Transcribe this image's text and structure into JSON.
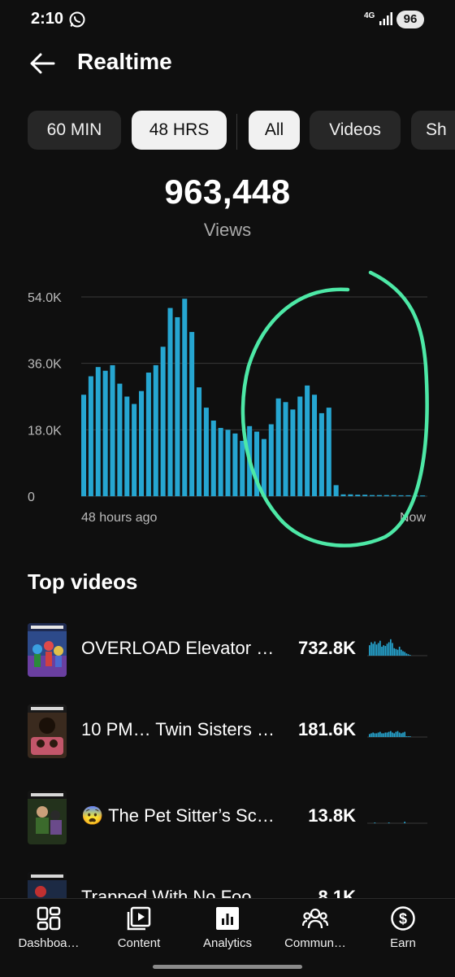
{
  "status": {
    "time": "2:10",
    "network": "4G",
    "battery": "96"
  },
  "header": {
    "title": "Realtime"
  },
  "range_tabs": [
    {
      "label": "60 MIN",
      "selected": false
    },
    {
      "label": "48 HRS",
      "selected": true
    }
  ],
  "type_tabs": [
    {
      "label": "All",
      "selected": true
    },
    {
      "label": "Videos",
      "selected": false
    },
    {
      "label": "Sh",
      "selected": false
    }
  ],
  "summary": {
    "total": "963,448",
    "label": "Views"
  },
  "chart_data": {
    "type": "bar",
    "x_start_label": "48 hours ago",
    "x_end_label": "Now",
    "yticks": [
      "0",
      "18.0K",
      "36.0K",
      "54.0K"
    ],
    "ylim": [
      0,
      54000
    ],
    "bar_color": "#26a6d1",
    "values": [
      27500,
      32500,
      35000,
      34000,
      35500,
      30500,
      27000,
      25000,
      28500,
      33500,
      35500,
      40500,
      51000,
      48500,
      53500,
      44500,
      29500,
      24000,
      20500,
      18500,
      18000,
      17000,
      15000,
      19000,
      17500,
      15500,
      19500,
      26500,
      25500,
      23500,
      27000,
      30000,
      27500,
      22500,
      24000,
      3000,
      500,
      500,
      400,
      400,
      300,
      300,
      300,
      300,
      250,
      250,
      200,
      200
    ],
    "annotation_color": "#4de8a6"
  },
  "top_videos": {
    "title": "Top videos",
    "items": [
      {
        "title": "OVERLOAD Elevator …",
        "views": "732.8K",
        "spark": [
          14,
          18,
          16,
          19,
          15,
          17,
          20,
          12,
          14,
          13,
          16,
          18,
          22,
          17,
          10,
          9,
          8,
          12,
          8,
          6,
          5,
          3,
          2,
          1
        ]
      },
      {
        "title": "10 PM… Twin Sisters …",
        "views": "181.6K",
        "spark": [
          4,
          5,
          6,
          5,
          5,
          6,
          7,
          5,
          5,
          6,
          6,
          7,
          8,
          6,
          5,
          7,
          8,
          6,
          5,
          6,
          7,
          1,
          1,
          1
        ]
      },
      {
        "title": "😨 The Pet Sitter’s Sc…",
        "views": "13.8K",
        "spark": [
          0,
          0,
          0,
          1,
          0,
          0,
          0,
          0,
          0,
          0,
          0,
          1,
          0,
          0,
          0,
          0,
          0,
          0,
          0,
          0,
          2,
          0,
          0,
          0
        ]
      },
      {
        "title": "Trapped With No Foo…",
        "views": "8.1K",
        "spark": []
      }
    ]
  },
  "nav": [
    {
      "label": "Dashboa…",
      "icon": "dashboard-icon"
    },
    {
      "label": "Content",
      "icon": "content-icon"
    },
    {
      "label": "Analytics",
      "icon": "analytics-icon"
    },
    {
      "label": "Commun…",
      "icon": "community-icon"
    },
    {
      "label": "Earn",
      "icon": "earn-icon"
    }
  ]
}
